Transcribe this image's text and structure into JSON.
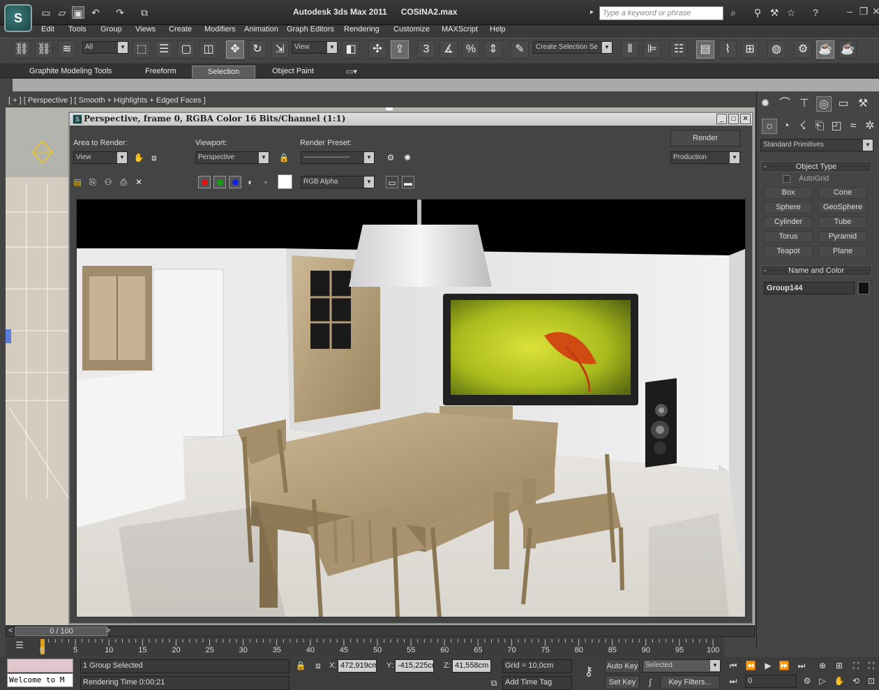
{
  "window": {
    "title": "Autodesk 3ds Max  2011",
    "file": "COSINA2.max",
    "search_placeholder": "Type a keyword or phrase"
  },
  "menu": [
    "Edit",
    "Tools",
    "Group",
    "Views",
    "Create",
    "Modifiers",
    "Animation",
    "Graph Editors",
    "Rendering",
    "Customize",
    "MAXScript",
    "Help"
  ],
  "toolbar": {
    "selection_filter": "All",
    "reference_coord": "View",
    "named_selection_placeholder": "Create Selection Se",
    "snap_value": "3"
  },
  "ribbon": {
    "tabs": [
      "Graphite Modeling Tools",
      "Freeform",
      "Selection",
      "Object Paint"
    ],
    "active_tab": "Selection"
  },
  "viewport": {
    "label": "[ + ] [ Perspective ] [ Smooth + Highlights + Edged Faces ]"
  },
  "render_window": {
    "title": "Perspective, frame 0, RGBA Color 16 Bits/Channel (1:1)",
    "area_to_render_label": "Area to Render:",
    "area_to_render_value": "View",
    "viewport_label": "Viewport:",
    "viewport_value": "Perspective",
    "render_preset_label": "Render Preset:",
    "render_preset_value": "--------------------",
    "render_button": "Render",
    "production_value": "Production",
    "channel_value": "RGB Alpha"
  },
  "command_panel": {
    "category": "Standard Primitives",
    "object_type_header": "Object Type",
    "autogrid_label": "AutoGrid",
    "primitives": [
      "Box",
      "Cone",
      "Sphere",
      "GeoSphere",
      "Cylinder",
      "Tube",
      "Torus",
      "Pyramid",
      "Teapot",
      "Plane"
    ],
    "name_color_header": "Name and Color",
    "object_name": "Group144"
  },
  "timeline": {
    "slider_text": "0 / 100",
    "ticks": [
      "0",
      "5",
      "10",
      "15",
      "20",
      "25",
      "30",
      "35",
      "40",
      "45",
      "50",
      "55",
      "60",
      "65",
      "70",
      "75",
      "80",
      "85",
      "90",
      "95",
      "100"
    ]
  },
  "status": {
    "welcome": "Welcome to M",
    "selection": "1 Group Selected",
    "rendering_time": "Rendering Time  0:00:21",
    "x_label": "X:",
    "x_value": "472,919cm",
    "y_label": "Y:",
    "y_value": "-415,225cm",
    "z_label": "Z:",
    "z_value": "41,558cm",
    "grid": "Grid = 10,0cm",
    "add_time_tag": "Add Time Tag",
    "auto_key": "Auto Key",
    "set_key": "Set Key",
    "key_mode": "Selected",
    "key_filters": "Key Filters...",
    "frame_value": "0"
  },
  "colors": {
    "accent": "#3c7d7e",
    "ui_bg": "#444444",
    "wall": "#e9e9e9",
    "wood": "#b59e79",
    "tv_screen": "#b7c520"
  }
}
